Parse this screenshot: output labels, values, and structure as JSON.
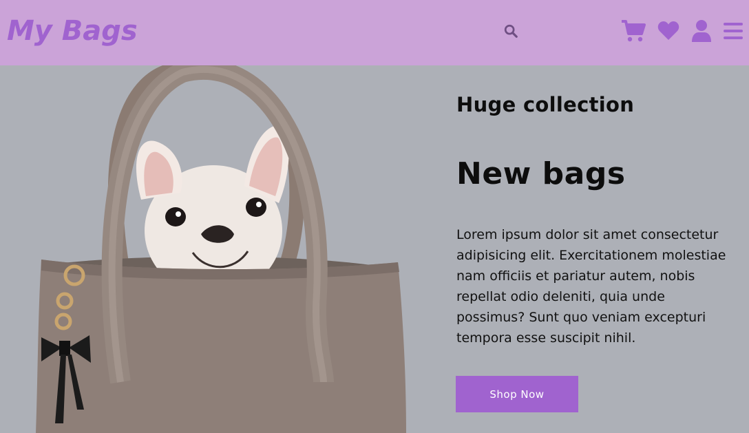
{
  "header": {
    "logo": "My Bags",
    "icons": [
      "search-icon",
      "cart-icon",
      "heart-icon",
      "user-icon",
      "menu-icon"
    ],
    "colors": {
      "background": "#cba3d8",
      "accent": "#a063cf"
    }
  },
  "hero": {
    "subtitle": "Huge collection",
    "title": "New bags",
    "description": "Lorem ipsum dolor sit amet consectetur adipisicing elit. Exercitationem molestiae nam officiis et pariatur autem, nobis repellat odio deleniti, quia unde possimus? Sunt quo veniam excepturi tempora esse suscipit nihil.",
    "button_label": "Shop Now",
    "image": "bag-with-puppy",
    "colors": {
      "background": "#adb0b7",
      "button": "#a063cf"
    }
  }
}
